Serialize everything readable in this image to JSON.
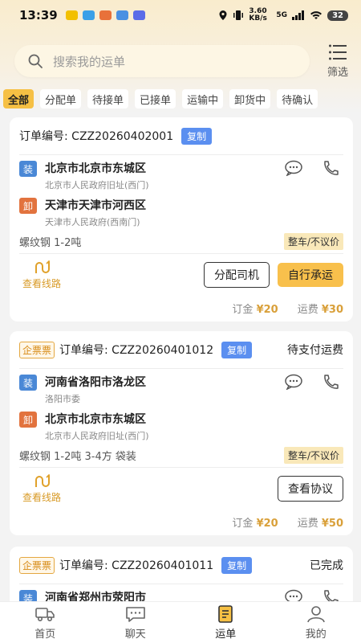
{
  "status_bar": {
    "time": "13:39",
    "net_speed": "3.60 KB/s",
    "net_type": "5G",
    "battery": "32"
  },
  "search": {
    "placeholder": "搜索我的运单",
    "filter_label": "筛选"
  },
  "tabs": [
    {
      "label": "全部",
      "active": true
    },
    {
      "label": "分配单"
    },
    {
      "label": "待接单"
    },
    {
      "label": "已接单"
    },
    {
      "label": "运输中"
    },
    {
      "label": "卸货中"
    },
    {
      "label": "待确认"
    }
  ],
  "orders": [
    {
      "order_label": "订单编号: CZZ20260402001",
      "copy": "复制",
      "badge": "",
      "status": "",
      "load": {
        "tag": "装",
        "city": "北京市北京市东城区",
        "detail": "北京市人民政府旧址(西门)"
      },
      "unload": {
        "tag": "卸",
        "city": "天津市天津市河西区",
        "detail": "天津市人民政府(西南门)"
      },
      "cargo": "螺纹钢 1-2吨",
      "price_tag": "整车/不议价",
      "route_label": "查看线路",
      "buttons": [
        "分配司机",
        "自行承运"
      ],
      "deposit_label": "订金",
      "deposit": "¥20",
      "freight_label": "运费",
      "freight": "¥30"
    },
    {
      "order_label": "订单编号: CZZ20260401012",
      "copy": "复制",
      "badge": "企票票",
      "status": "待支付运费",
      "load": {
        "tag": "装",
        "city": "河南省洛阳市洛龙区",
        "detail": "洛阳市委"
      },
      "unload": {
        "tag": "卸",
        "city": "北京市北京市东城区",
        "detail": "北京市人民政府旧址(西门)"
      },
      "cargo": "螺纹钢 1-2吨 3-4方 袋装",
      "price_tag": "整车/不议价",
      "route_label": "查看线路",
      "buttons": [
        "查看协议"
      ],
      "deposit_label": "订金",
      "deposit": "¥20",
      "freight_label": "运费",
      "freight": "¥50"
    },
    {
      "order_label": "订单编号: CZZ20260401011",
      "copy": "复制",
      "badge": "企票票",
      "status": "已完成",
      "load": {
        "tag": "装",
        "city": "河南省郑州市荥阳市",
        "detail": ""
      }
    }
  ],
  "bottom_nav": [
    {
      "label": "首页",
      "icon": "truck-icon"
    },
    {
      "label": "聊天",
      "icon": "chat-icon"
    },
    {
      "label": "运单",
      "icon": "waybill-icon",
      "active": true
    },
    {
      "label": "我的",
      "icon": "profile-icon"
    }
  ],
  "colors": {
    "accent": "#f6c044",
    "copy_blue": "#5b8ff0",
    "load_tag": "#4a88d6",
    "unload_tag": "#e2733e",
    "fee": "#d9a03a"
  }
}
